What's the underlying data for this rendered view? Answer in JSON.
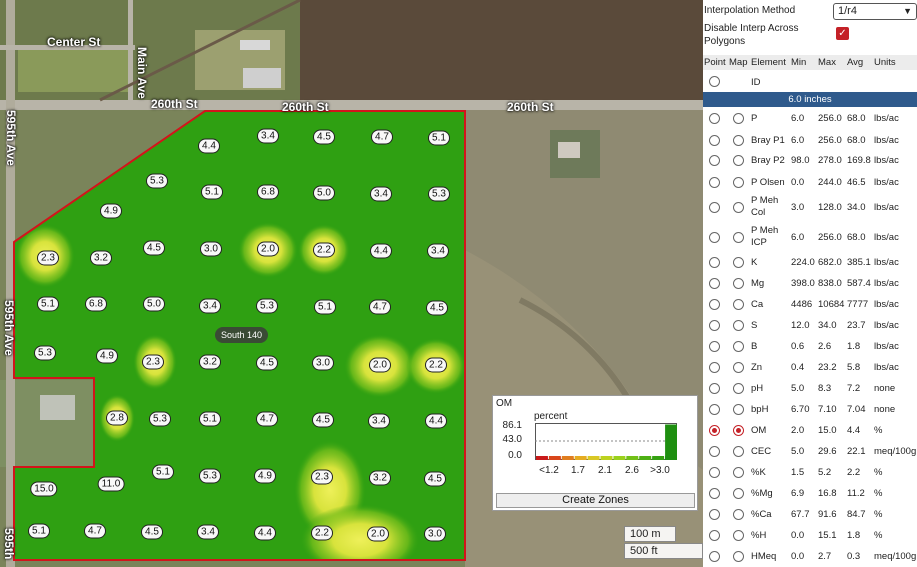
{
  "map": {
    "roads": [
      {
        "label": "Center St"
      },
      {
        "label": "Main Ave"
      },
      {
        "label": "260th St"
      },
      {
        "label": "260th St"
      },
      {
        "label": "260th St"
      },
      {
        "label": "595th Ave"
      },
      {
        "label": "595th Ave"
      },
      {
        "label": "595th"
      }
    ],
    "field_label": "South 140",
    "points": [
      "4.4",
      "3.4",
      "4.5",
      "4.7",
      "5.1",
      "5.3",
      "5.1",
      "6.8",
      "5.0",
      "3.4",
      "5.3",
      "4.9",
      "2.3",
      "3.2",
      "4.5",
      "3.0",
      "2.0",
      "2.2",
      "4.4",
      "3.4",
      "5.1",
      "6.8",
      "5.0",
      "3.4",
      "5.3",
      "5.1",
      "4.7",
      "4.5",
      "5.3",
      "4.9",
      "2.3",
      "3.2",
      "4.5",
      "3.0",
      "2.0",
      "2.2",
      "2.8",
      "5.3",
      "5.1",
      "4.7",
      "4.5",
      "3.4",
      "4.4",
      "5.1",
      "5.3",
      "4.9",
      "2.3",
      "3.2",
      "4.5",
      "15.0",
      "11.0",
      "5.1",
      "4.7",
      "4.5",
      "3.4",
      "4.4",
      "2.2",
      "2.0",
      "3.0"
    ],
    "scale_m": "100 m",
    "scale_ft": "500 ft",
    "colors": {
      "field": "#2fa012",
      "boundary": "#d3141b",
      "hot": "#e2e44a"
    }
  },
  "legend": {
    "title": "OM",
    "unit": "percent",
    "y_labels": [
      "86.1",
      "43.0",
      "0.0"
    ],
    "x_labels": [
      "<1.2",
      "1.7",
      "2.1",
      "2.6",
      ">3.0"
    ],
    "bins": [
      {
        "color": "#c91a1a",
        "value": 0.3
      },
      {
        "color": "#d9461b",
        "value": 0.3
      },
      {
        "color": "#e07d1f",
        "value": 0.4
      },
      {
        "color": "#e5ac22",
        "value": 0.6
      },
      {
        "color": "#d9c825",
        "value": 0.8
      },
      {
        "color": "#bcd21f",
        "value": 0.9
      },
      {
        "color": "#9ad11c",
        "value": 1.0
      },
      {
        "color": "#72c018",
        "value": 1.5
      },
      {
        "color": "#4db014",
        "value": 2.5
      },
      {
        "color": "#35a112",
        "value": 3.5
      },
      {
        "color": "#1e8f10",
        "value": 86.1
      }
    ],
    "create_zones": "Create Zones"
  },
  "panel": {
    "interp_label": "Interpolation Method",
    "interp_value": "1/r4",
    "disable_label": "Disable Interp Across Polygons",
    "disable_checked": "✓",
    "headers": {
      "point": "Point",
      "map": "Map",
      "element": "Element",
      "min": "Min",
      "max": "Max",
      "avg": "Avg",
      "units": "Units"
    },
    "id_label": "ID",
    "depth": "6.0 inches",
    "rows": [
      {
        "el": "P",
        "min": "6.0",
        "max": "256.0",
        "avg": "68.0",
        "units": "lbs/ac"
      },
      {
        "el": "Bray P1",
        "min": "6.0",
        "max": "256.0",
        "avg": "68.0",
        "units": "lbs/ac"
      },
      {
        "el": "Bray P2",
        "min": "98.0",
        "max": "278.0",
        "avg": "169.8",
        "units": "lbs/ac"
      },
      {
        "el": "P Olsen",
        "min": "0.0",
        "max": "244.0",
        "avg": "46.5",
        "units": "lbs/ac"
      },
      {
        "el": "P Meh Col",
        "min": "3.0",
        "max": "128.0",
        "avg": "34.0",
        "units": "lbs/ac"
      },
      {
        "el": "P Meh ICP",
        "min": "6.0",
        "max": "256.0",
        "avg": "68.0",
        "units": "lbs/ac"
      },
      {
        "el": "K",
        "min": "224.0",
        "max": "682.0",
        "avg": "385.1",
        "units": "lbs/ac"
      },
      {
        "el": "Mg",
        "min": "398.0",
        "max": "838.0",
        "avg": "587.4",
        "units": "lbs/ac"
      },
      {
        "el": "Ca",
        "min": "4486",
        "max": "10684",
        "avg": "7777",
        "units": "lbs/ac"
      },
      {
        "el": "S",
        "min": "12.0",
        "max": "34.0",
        "avg": "23.7",
        "units": "lbs/ac"
      },
      {
        "el": "B",
        "min": "0.6",
        "max": "2.6",
        "avg": "1.8",
        "units": "lbs/ac"
      },
      {
        "el": "Zn",
        "min": "0.4",
        "max": "23.2",
        "avg": "5.8",
        "units": "lbs/ac"
      },
      {
        "el": "pH",
        "min": "5.0",
        "max": "8.3",
        "avg": "7.2",
        "units": "none"
      },
      {
        "el": "bpH",
        "min": "6.70",
        "max": "7.10",
        "avg": "7.04",
        "units": "none"
      },
      {
        "el": "OM",
        "min": "2.0",
        "max": "15.0",
        "avg": "4.4",
        "units": "%"
      },
      {
        "el": "CEC",
        "min": "5.0",
        "max": "29.6",
        "avg": "22.1",
        "units": "meq/100g"
      },
      {
        "el": "%K",
        "min": "1.5",
        "max": "5.2",
        "avg": "2.2",
        "units": "%"
      },
      {
        "el": "%Mg",
        "min": "6.9",
        "max": "16.8",
        "avg": "11.2",
        "units": "%"
      },
      {
        "el": "%Ca",
        "min": "67.7",
        "max": "91.6",
        "avg": "84.7",
        "units": "%"
      },
      {
        "el": "%H",
        "min": "0.0",
        "max": "15.1",
        "avg": "1.8",
        "units": "%"
      },
      {
        "el": "HMeq",
        "min": "0.0",
        "max": "2.7",
        "avg": "0.3",
        "units": "meq/100g"
      }
    ]
  }
}
